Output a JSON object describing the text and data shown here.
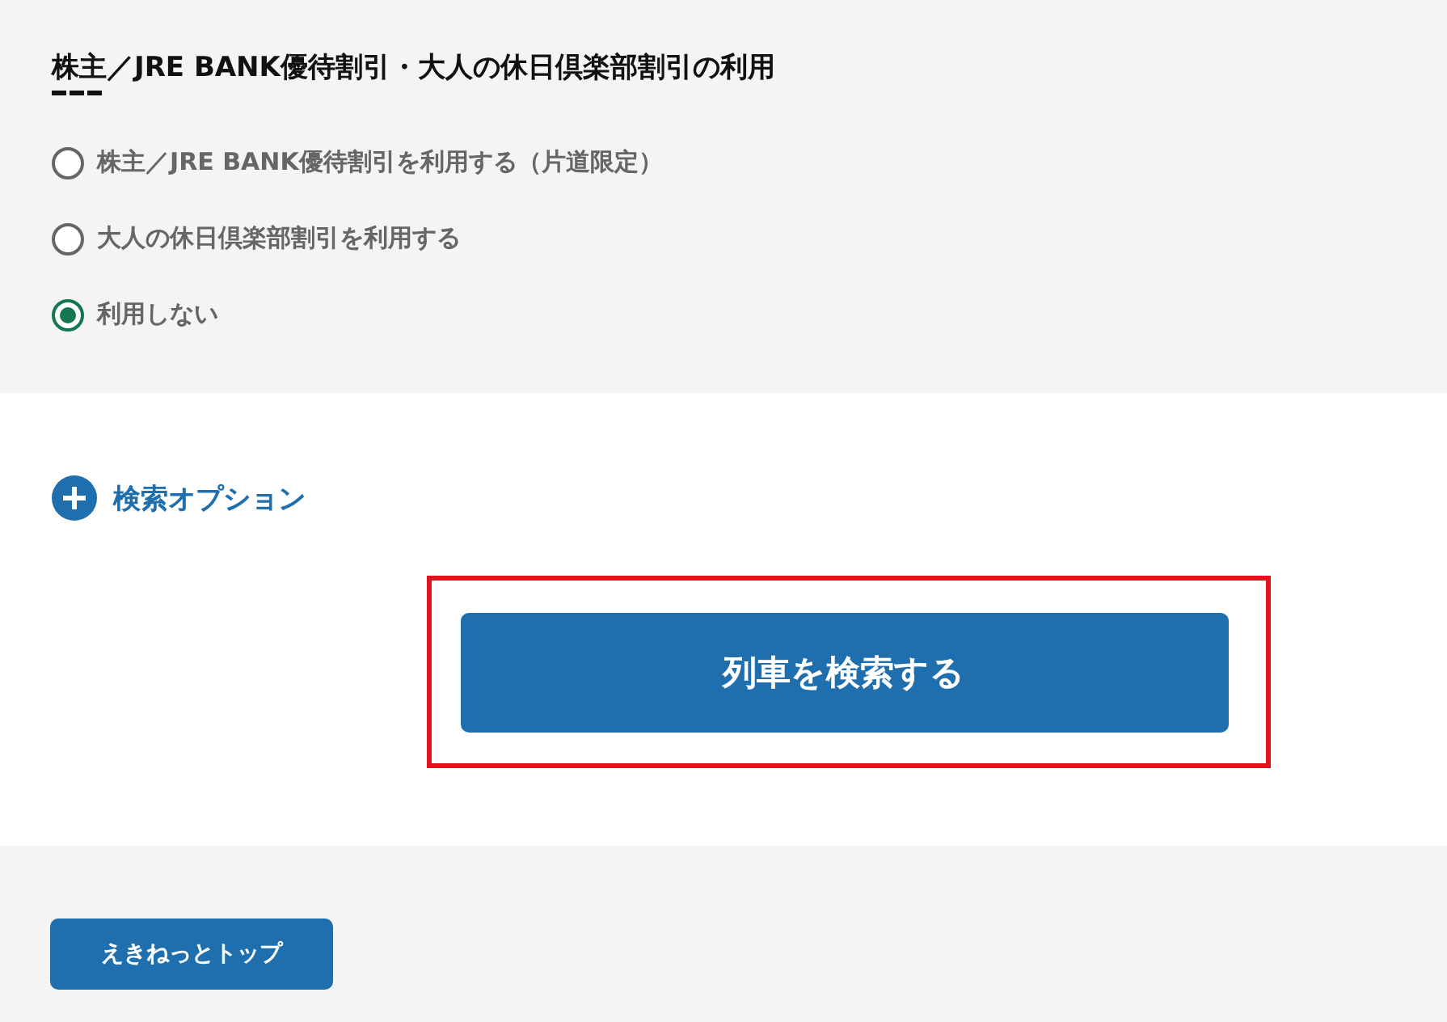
{
  "discount_section": {
    "title": "株主／JRE BANK優待割引・大人の休日倶楽部割引の利用",
    "options": [
      {
        "label": "株主／JRE BANK優待割引を利用する（片道限定）",
        "selected": false
      },
      {
        "label": "大人の休日倶楽部割引を利用する",
        "selected": false
      },
      {
        "label": "利用しない",
        "selected": true
      }
    ]
  },
  "search_options": {
    "label": "検索オプション",
    "expanded": false
  },
  "search_button": {
    "label": "列車を検索する",
    "highlighted": true
  },
  "footer": {
    "top_button": "えきねっとトップ"
  }
}
